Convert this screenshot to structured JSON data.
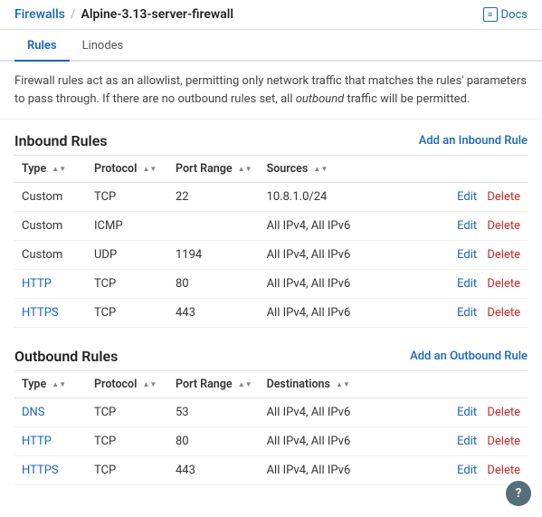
{
  "header": {
    "breadcrumb_parent": "Firewalls",
    "breadcrumb_separator": "/",
    "breadcrumb_current": "Alpine-3.13-server-firewall",
    "docs_label": "Docs"
  },
  "tabs": [
    {
      "label": "Rules",
      "active": true
    },
    {
      "label": "Linodes",
      "active": false
    }
  ],
  "description": {
    "text1": "Firewall rules act as an allowlist, permitting only network traffic that matches the rules' parameters to pass through. If there are no outbound rules set, all ",
    "text2": "outbound",
    "text3": " traffic will be permitted."
  },
  "inbound": {
    "title": "Inbound Rules",
    "add_label": "Add an Inbound Rule",
    "columns": [
      "Type",
      "Protocol",
      "Port Range",
      "Sources"
    ],
    "rows": [
      {
        "type": "Custom",
        "protocol": "TCP",
        "port_range": "22",
        "sources": "10.8.1.0/24",
        "type_is_link": false
      },
      {
        "type": "Custom",
        "protocol": "ICMP",
        "port_range": "",
        "sources": "All IPv4, All IPv6",
        "type_is_link": false
      },
      {
        "type": "Custom",
        "protocol": "UDP",
        "port_range": "1194",
        "sources": "All IPv4, All IPv6",
        "type_is_link": false
      },
      {
        "type": "HTTP",
        "protocol": "TCP",
        "port_range": "80",
        "sources": "All IPv4, All IPv6",
        "type_is_link": true
      },
      {
        "type": "HTTPS",
        "protocol": "TCP",
        "port_range": "443",
        "sources": "All IPv4, All IPv6",
        "type_is_link": true
      }
    ],
    "edit_label": "Edit",
    "delete_label": "Delete"
  },
  "outbound": {
    "title": "Outbound Rules",
    "add_label": "Add an Outbound Rule",
    "columns": [
      "Type",
      "Protocol",
      "Port Range",
      "Destinations"
    ],
    "rows": [
      {
        "type": "DNS",
        "protocol": "TCP",
        "port_range": "53",
        "destinations": "All IPv4, All IPv6",
        "type_is_link": true
      },
      {
        "type": "HTTP",
        "protocol": "TCP",
        "port_range": "80",
        "destinations": "All IPv4, All IPv6",
        "type_is_link": true
      },
      {
        "type": "HTTPS",
        "protocol": "TCP",
        "port_range": "443",
        "destinations": "All IPv4, All IPv6",
        "type_is_link": true
      }
    ],
    "edit_label": "Edit",
    "delete_label": "Delete"
  },
  "help_btn_label": "?"
}
